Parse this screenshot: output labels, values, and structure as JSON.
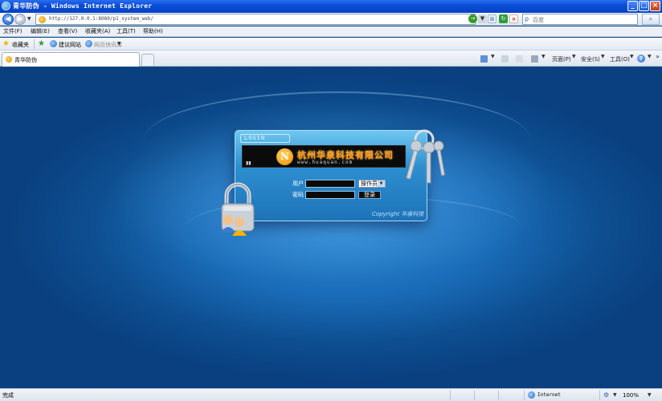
{
  "window": {
    "title": "青华防伪 - Windows Internet Explorer"
  },
  "address": {
    "url": "http://127.0.0.1:8080/p1_system_web/"
  },
  "search": {
    "placeholder": "百度"
  },
  "menu": [
    "文件(F)",
    "编辑(E)",
    "查看(V)",
    "收藏夹(A)",
    "工具(T)",
    "帮助(H)"
  ],
  "favorites": {
    "label": "收藏夹",
    "links": [
      "建议网站",
      "网页快讯库"
    ]
  },
  "tab": {
    "label": "青华防伪"
  },
  "commands": {
    "page": "页面(P)",
    "safety": "安全(S)",
    "tools": "工具(O)"
  },
  "login": {
    "tag": "LOGIN",
    "company_name": "杭州华泉科技有限公司",
    "company_url": "www.huaquan.com",
    "username_label": "用户",
    "password_label": "密码",
    "role_value": "操作员",
    "login_button": "登录",
    "copyright": "Copyright 华泉科技"
  },
  "status": {
    "text": "完成",
    "zone": "Internet",
    "zoom": "100%"
  }
}
